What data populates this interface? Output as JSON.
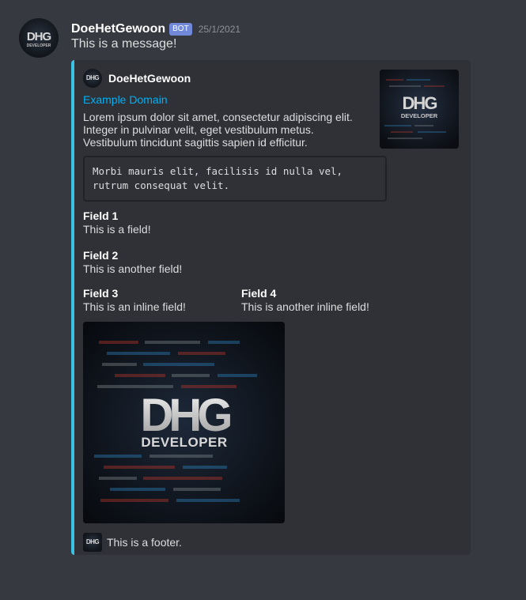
{
  "message": {
    "username": "DoeHetGewoon",
    "bot_tag": "BOT",
    "timestamp": "25/1/2021",
    "content": "This is a message!"
  },
  "embed": {
    "accent_color": "#3ac1e3",
    "author": {
      "name": "DoeHetGewoon",
      "icon": "dhg-logo-icon"
    },
    "title": "Example Domain",
    "description_lines": [
      "Lorem ipsum dolor sit amet, consectetur adipiscing elit.",
      "Integer in pulvinar velit, eget vestibulum metus.",
      "Vestibulum tincidunt sagittis sapien id efficitur."
    ],
    "code_lines": [
      "Morbi mauris elit, facilisis id nulla vel,",
      "rutrum consequat velit."
    ],
    "fields": [
      {
        "name": "Field 1",
        "value": "This is a field!"
      },
      {
        "name": "Field 2",
        "value": "This is another field!"
      },
      {
        "name": "Field 3",
        "value": "This is an inline field!"
      },
      {
        "name": "Field 4",
        "value": "This is another inline field!"
      }
    ],
    "logo_text": {
      "mark": "DHG",
      "sub": "DEVELOPER"
    },
    "footer": "This is a footer."
  },
  "colors": {
    "background": "#36393f",
    "embed_background": "#2f3136",
    "link": "#00b0f4",
    "bot_tag": "#7289da"
  }
}
